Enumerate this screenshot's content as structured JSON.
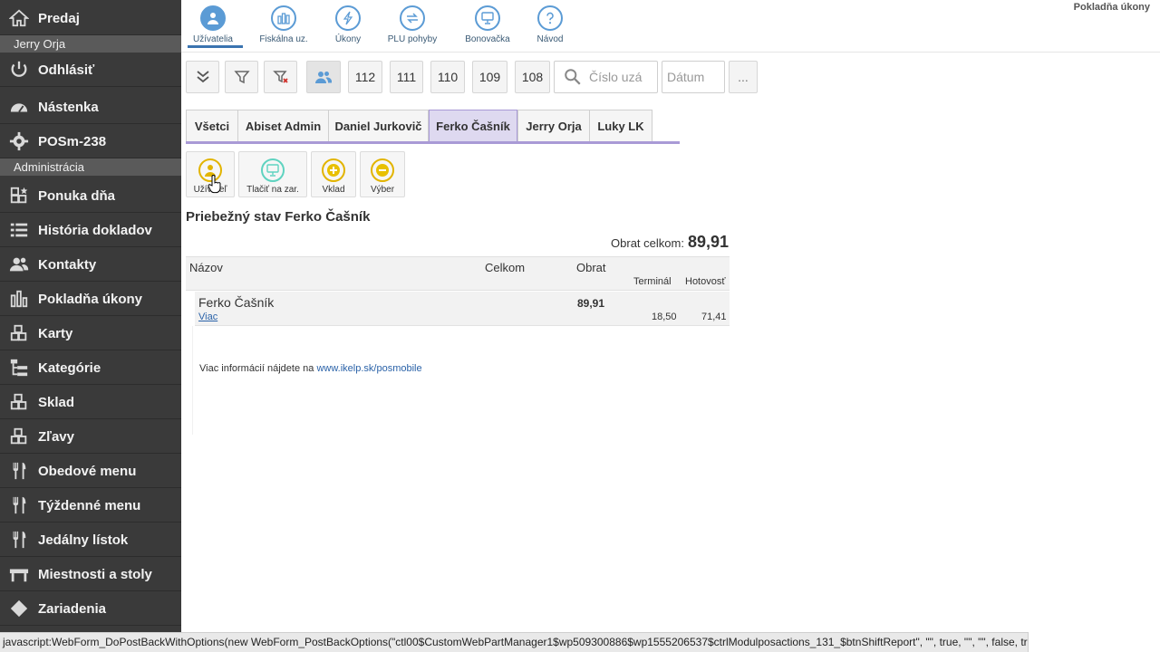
{
  "sidebar": {
    "items": [
      {
        "label": "Predaj",
        "icon": "home-icon"
      },
      {
        "label": "Odhlásiť",
        "icon": "power-icon"
      },
      {
        "label": "Nástenka",
        "icon": "dashboard-icon"
      },
      {
        "label": "POSm-238",
        "icon": "gear-icon"
      },
      {
        "label": "Ponuka dňa",
        "icon": "boxes-star-icon"
      },
      {
        "label": "História dokladov",
        "icon": "list-icon"
      },
      {
        "label": "Kontakty",
        "icon": "people-icon"
      },
      {
        "label": "Pokladňa úkony",
        "icon": "bar-chart-icon"
      },
      {
        "label": "Karty",
        "icon": "boxes-icon"
      },
      {
        "label": "Kategórie",
        "icon": "tree-icon"
      },
      {
        "label": "Sklad",
        "icon": "boxes-icon"
      },
      {
        "label": "Zľavy",
        "icon": "boxes-icon"
      },
      {
        "label": "Obedové menu",
        "icon": "cutlery-icon"
      },
      {
        "label": "Týždenné menu",
        "icon": "cutlery-icon"
      },
      {
        "label": "Jedálny lístok",
        "icon": "cutlery-icon"
      },
      {
        "label": "Miestnosti a stoly",
        "icon": "table-icon"
      },
      {
        "label": "Zariadenia",
        "icon": "diamond-icon"
      }
    ],
    "sub_user": "Jerry Orja",
    "sub_admin": "Administrácia"
  },
  "top_tabs": [
    {
      "label": "Užívatelia",
      "icon": "user-icon"
    },
    {
      "label": "Fiskálna uz.",
      "icon": "bars-icon"
    },
    {
      "label": "Úkony",
      "icon": "bolt-icon"
    },
    {
      "label": "PLU pohyby",
      "icon": "arrows-icon"
    },
    {
      "label": "Bonovačka",
      "icon": "monitor-icon"
    },
    {
      "label": "Návod",
      "icon": "question-icon"
    }
  ],
  "page_title": "Pokladňa úkony",
  "filters": {
    "numbers": [
      "112",
      "111",
      "110",
      "109",
      "108"
    ],
    "search_placeholder": "Číslo uzá",
    "date_placeholder": "Dátum",
    "more_label": "..."
  },
  "user_tabs": [
    "Všetci",
    "Abiset Admin",
    "Daniel Jurkovič",
    "Ferko Čašník",
    "Jerry Orja",
    "Luky LK"
  ],
  "actions": {
    "user": "Užívateľ",
    "print": "Tlačiť na zar.",
    "deposit": "Vklad",
    "withdraw": "Výber"
  },
  "report": {
    "title": "Priebežný stav Ferko Čašník",
    "turnover_label": "Obrat celkom:",
    "turnover_value": "89,91",
    "columns": {
      "name": "Názov",
      "total": "Celkom",
      "turnover": "Obrat",
      "terminal": "Terminál",
      "cash": "Hotovosť"
    },
    "row": {
      "name": "Ferko Čašník",
      "more": "Viac",
      "turnover": "89,91",
      "terminal": "18,50",
      "cash": "71,41"
    }
  },
  "footer": {
    "text": "Viac informácií nájdete na",
    "link": "www.ikelp.sk/posmobile"
  },
  "status_bar": "javascript:WebForm_DoPostBackWithOptions(new WebForm_PostBackOptions(\"ctl00$CustomWebPartManager1$wp509300886$wp1555206537$ctrlModulposactions_131_$btnShiftReport\", \"\", true, \"\", \"\", false, true))",
  "colors": {
    "accent": "#5b9bd5",
    "sidebar": "#3a3a3a",
    "active_tab": "#ded9f0",
    "action_yellow": "#e2b400",
    "action_teal": "#5fd3c0"
  }
}
